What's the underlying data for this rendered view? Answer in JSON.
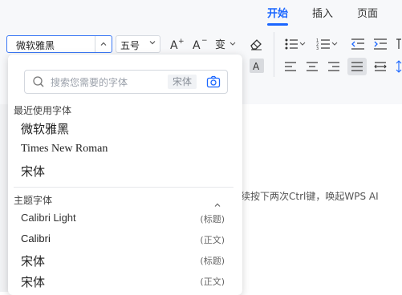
{
  "ribbon": {
    "tabs": [
      {
        "label": "开始",
        "active": true
      },
      {
        "label": "插入",
        "active": false
      },
      {
        "label": "页面",
        "active": false
      }
    ],
    "font_name": "微软雅黑",
    "font_size": "五号",
    "accent_color": "#1a66ff"
  },
  "document": {
    "hint_text": "续按下两次Ctrl键，唤起WPS AI"
  },
  "font_dropdown": {
    "search": {
      "placeholder": "搜索您需要的字体",
      "scope_tag": "宋体"
    },
    "recent": {
      "title": "最近使用字体",
      "items": [
        "微软雅黑",
        "Times New Roman",
        "宋体"
      ]
    },
    "theme": {
      "title": "主题字体",
      "items": [
        {
          "name": "Calibri Light",
          "tag": "(标题)"
        },
        {
          "name": "Calibri",
          "tag": "(正文)"
        },
        {
          "name": "宋体",
          "tag": "(标题)"
        },
        {
          "name": "宋体",
          "tag": "(正文)"
        }
      ]
    }
  }
}
